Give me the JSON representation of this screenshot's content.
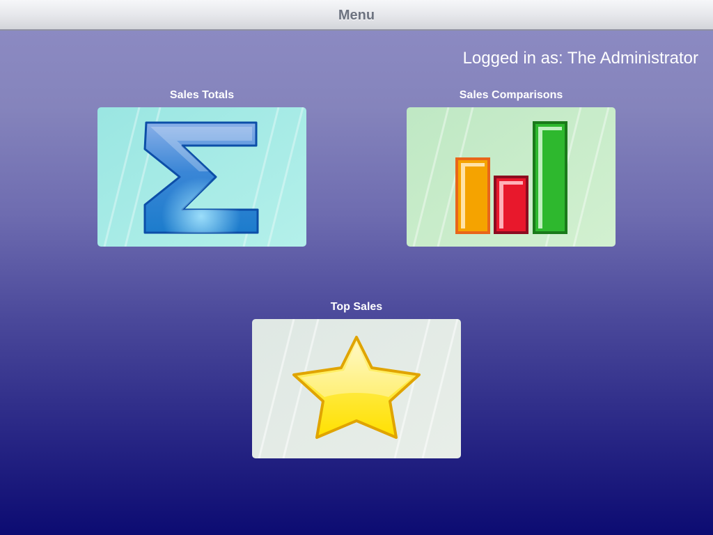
{
  "navbar": {
    "title": "Menu"
  },
  "user": {
    "login_status": "Logged in as: The Administrator"
  },
  "tiles": [
    {
      "label": "Sales Totals",
      "icon": "sigma-icon",
      "background": "#a8ece6"
    },
    {
      "label": "Sales Comparisons",
      "icon": "bar-chart-icon",
      "background": "#c8ecc8"
    },
    {
      "label": "Top Sales",
      "icon": "star-icon",
      "background": "#e2ece6"
    }
  ],
  "colors": {
    "sigma_blue": "#2a8ad4",
    "bar_orange": "#f5a300",
    "bar_red": "#e8182c",
    "bar_green": "#2eb82e",
    "star_yellow": "#ffe000"
  }
}
